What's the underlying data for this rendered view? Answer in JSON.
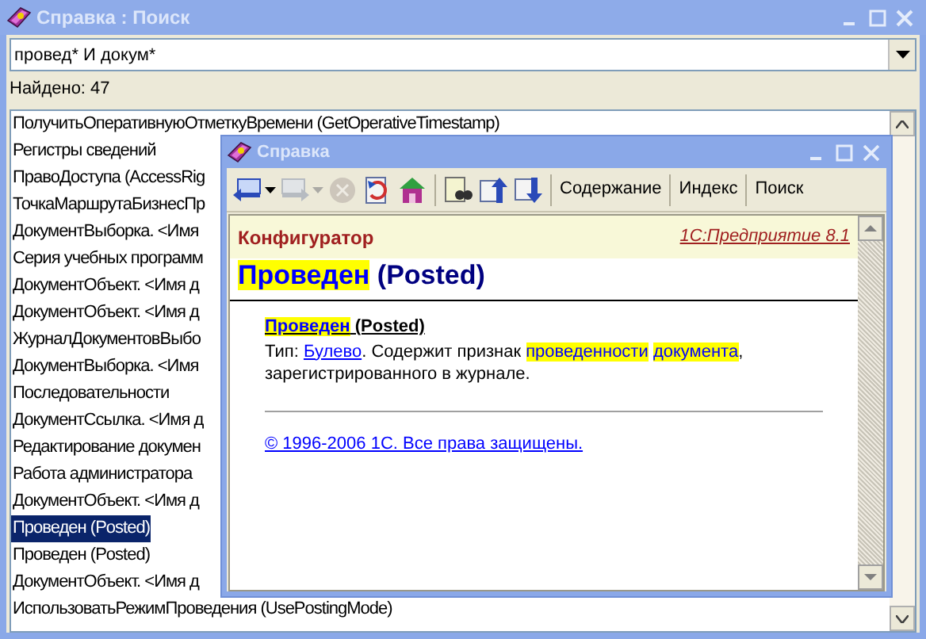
{
  "window": {
    "title": "Справка : Поиск"
  },
  "search": {
    "value": "провед* И докум*"
  },
  "found_label": "Найдено: 47",
  "results": [
    {
      "text": "ПолучитьОперативнуюОтметкуВремени (GetOperativeTimestamp)",
      "selected": false
    },
    {
      "text": "Регистры сведений",
      "selected": false
    },
    {
      "text": "ПравоДоступа (AccessRig",
      "selected": false
    },
    {
      "text": "ТочкаМаршрутаБизнесПр",
      "selected": false
    },
    {
      "text": "ДокументВыборка. <Имя",
      "selected": false
    },
    {
      "text": "Серия учебных программ",
      "selected": false
    },
    {
      "text": "ДокументОбъект. <Имя д",
      "selected": false
    },
    {
      "text": "ДокументОбъект. <Имя д",
      "selected": false
    },
    {
      "text": "ЖурналДокументовВыбо",
      "selected": false
    },
    {
      "text": "ДокументВыборка. <Имя",
      "selected": false
    },
    {
      "text": "Последовательности",
      "selected": false
    },
    {
      "text": "ДокументСсылка. <Имя д",
      "selected": false
    },
    {
      "text": "Редактирование докумен",
      "selected": false
    },
    {
      "text": "Работа администратора",
      "selected": false
    },
    {
      "text": "ДокументОбъект. <Имя д",
      "selected": false
    },
    {
      "text": "Проведен (Posted)",
      "selected": true
    },
    {
      "text": "Проведен (Posted)",
      "selected": false
    },
    {
      "text": "ДокументОбъект. <Имя д",
      "selected": false
    },
    {
      "text": "ИспользоватьРежимПроведения (UsePostingMode)",
      "selected": false
    }
  ],
  "help_window": {
    "title": "Справка",
    "toolbar": [
      {
        "kind": "back",
        "disabled": false,
        "dropdown": true
      },
      {
        "kind": "forward",
        "disabled": true,
        "dropdown": true
      },
      {
        "kind": "stop",
        "disabled": true,
        "dropdown": false
      },
      {
        "kind": "refresh",
        "disabled": false,
        "dropdown": false
      },
      {
        "kind": "home",
        "disabled": false,
        "dropdown": false
      },
      {
        "kind": "find",
        "disabled": false,
        "dropdown": false
      },
      {
        "kind": "up",
        "disabled": false,
        "dropdown": false
      },
      {
        "kind": "down",
        "disabled": false,
        "dropdown": false
      }
    ],
    "tabs": [
      "Содержание",
      "Индекс",
      "Поиск"
    ],
    "product": "Конфигуратор",
    "version_link": "1С:Предприятие 8.1",
    "heading": [
      {
        "text": "Проведен",
        "highlight": true
      },
      {
        "text": " (Posted)",
        "highlight": false
      }
    ],
    "term": [
      {
        "text": "Проведен",
        "highlight": true
      },
      {
        "text": " (Posted)",
        "highlight": false
      }
    ],
    "description": [
      {
        "text": "Тип: ",
        "link": false,
        "highlight": false
      },
      {
        "text": "Булево",
        "link": true,
        "highlight": false
      },
      {
        "text": ". Содержит признак ",
        "link": false,
        "highlight": false
      },
      {
        "text": "проведенности ",
        "link": false,
        "highlight": true
      },
      {
        "text": "документа",
        "link": false,
        "highlight": true
      },
      {
        "text": ", зарегистрированного в журнале.",
        "link": false,
        "highlight": false
      }
    ],
    "copyright_link": "© 1996-2006 1С. Все права защищены."
  }
}
